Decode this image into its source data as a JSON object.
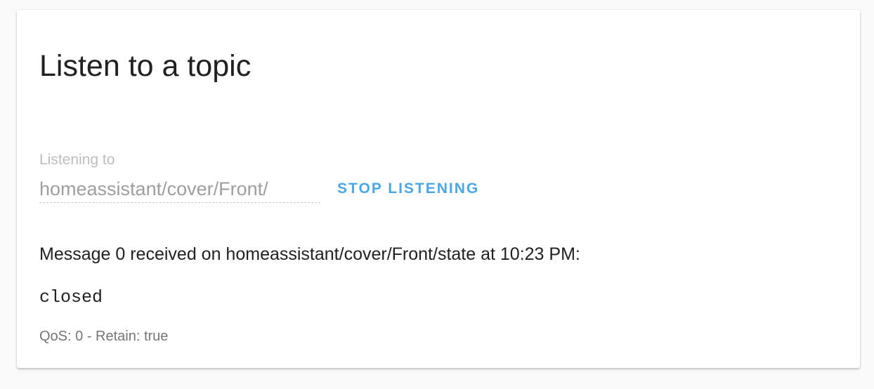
{
  "card": {
    "title": "Listen to a topic"
  },
  "listen_field": {
    "label": "Listening to",
    "value": "homeassistant/cover/Front/"
  },
  "stop_button": {
    "label": "Stop listening"
  },
  "message": {
    "header": "Message 0 received on homeassistant/cover/Front/state at 10:23 PM:",
    "payload": "closed",
    "meta": "QoS: 0 - Retain: true"
  },
  "colors": {
    "accent": "#4aa8e8",
    "background": "#fafafa",
    "card": "#ffffff",
    "primary_text": "#212121",
    "secondary_text": "#757575",
    "disabled_text": "#bdbdbd"
  }
}
